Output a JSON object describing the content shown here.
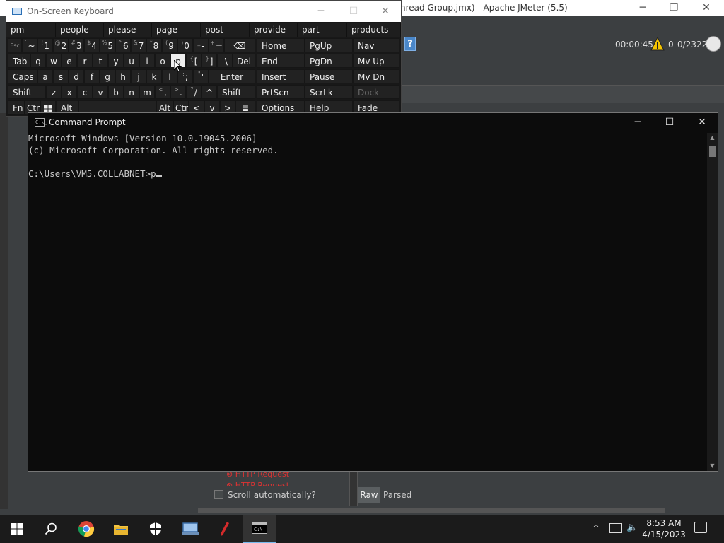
{
  "jmeter": {
    "title": "hread Group.jmx) - Apache JMeter (5.5)",
    "controls": {
      "minimize": "─",
      "maximize": "❐",
      "close": "✕"
    },
    "help_label": "?",
    "timer": "00:00:45",
    "error_count": "0",
    "thread_count": "0/2322",
    "tree_items": [
      "HTTP Request",
      "HTTP Request"
    ],
    "scroll_label": "Scroll automatically?",
    "raw_label": "Raw",
    "parsed_label": "Parsed",
    "colors": {
      "error": "#dd3333",
      "warning": "#f5c400"
    }
  },
  "osk": {
    "title": "On-Screen Keyboard",
    "controls": {
      "minimize": "─",
      "maximize": "☐",
      "close": "✕"
    },
    "predictions": [
      "pm",
      "people",
      "please",
      "page",
      "post",
      "provide",
      "part",
      "products"
    ],
    "row1": [
      {
        "main": "Esc",
        "sup": ""
      },
      {
        "main": "~",
        "sup": "`"
      },
      {
        "main": "1",
        "sup": "!"
      },
      {
        "main": "2",
        "sup": "@"
      },
      {
        "main": "3",
        "sup": "#"
      },
      {
        "main": "4",
        "sup": "$"
      },
      {
        "main": "5",
        "sup": "%"
      },
      {
        "main": "6",
        "sup": "^"
      },
      {
        "main": "7",
        "sup": "&"
      },
      {
        "main": "8",
        "sup": "*"
      },
      {
        "main": "9",
        "sup": "("
      },
      {
        "main": "0",
        "sup": ")"
      },
      {
        "main": "-",
        "sup": "_"
      },
      {
        "main": "=",
        "sup": "+"
      },
      {
        "main": "⌫",
        "sup": ""
      }
    ],
    "row2": [
      "Tab",
      "q",
      "w",
      "e",
      "r",
      "t",
      "y",
      "u",
      "i",
      "o",
      "p",
      "[",
      "]",
      "\\",
      "Del"
    ],
    "row2_sup": {
      "bracket_open": "{",
      "bracket_close": "}",
      "backslash": "|"
    },
    "row3": [
      "Caps",
      "a",
      "s",
      "d",
      "f",
      "g",
      "h",
      "j",
      "k",
      "l",
      ";",
      "'",
      "Enter"
    ],
    "row3_sup": {
      "semicolon": ":",
      "quote": "\""
    },
    "row4": [
      "Shift",
      "z",
      "x",
      "c",
      "v",
      "b",
      "n",
      "m",
      ",",
      ".",
      "/",
      "^",
      "Shift"
    ],
    "row4_sup": {
      "comma": "<",
      "period": ">",
      "slash": "?"
    },
    "row5": [
      "Fn",
      "Ctrl",
      "Alt",
      "Alt",
      "Ctrl",
      "<",
      "v",
      ">",
      "≣"
    ],
    "nav_col1": [
      "Home",
      "End",
      "Insert",
      "PrtScn",
      "Options"
    ],
    "nav_col2": [
      "PgUp",
      "PgDn",
      "Pause",
      "ScrLk",
      "Help"
    ],
    "nav_col3": [
      "Nav",
      "Mv Up",
      "Mv Dn",
      "Dock",
      "Fade"
    ],
    "pressed_key": "p"
  },
  "cmd": {
    "title": "Command Prompt",
    "icon_text": "C:\\_",
    "controls": {
      "minimize": "─",
      "maximize": "☐",
      "close": "✕"
    },
    "lines": [
      "Microsoft Windows [Version 10.0.19045.2006]",
      "(c) Microsoft Corporation. All rights reserved.",
      "",
      "C:\\Users\\VM5.COLLABNET>p"
    ]
  },
  "taskbar": {
    "apps": [
      "start",
      "search",
      "chrome",
      "file-explorer",
      "security",
      "network-app",
      "pen-app",
      "command-prompt"
    ],
    "time": "8:53 AM",
    "date": "4/15/2023",
    "tray_chevron": "^",
    "volume_glyph": "🔈"
  }
}
